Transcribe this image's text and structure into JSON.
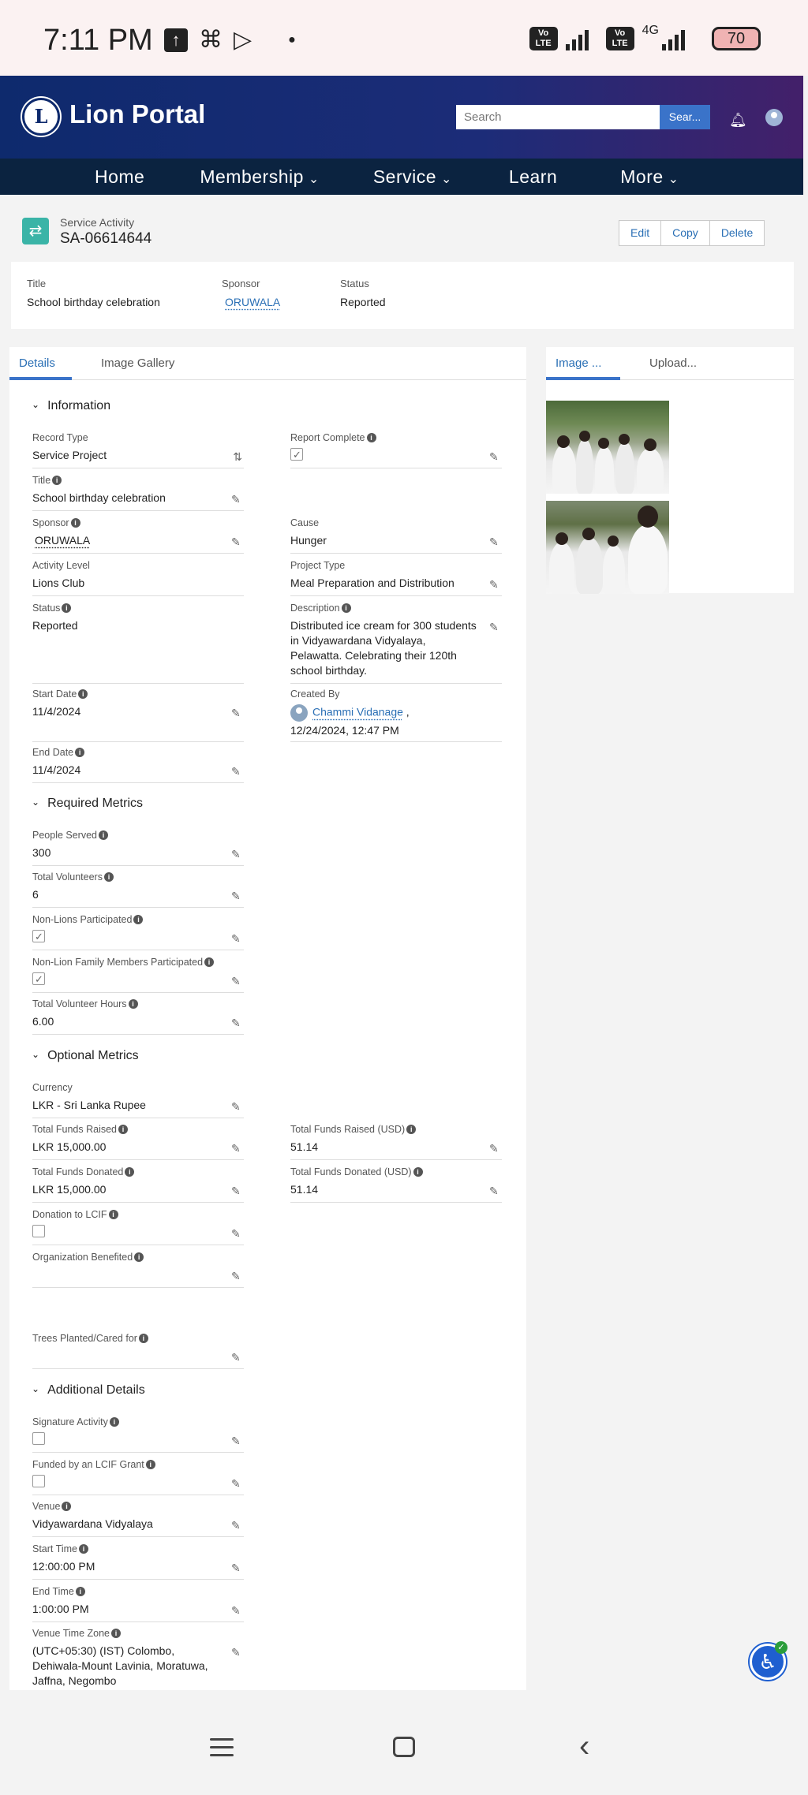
{
  "status_bar": {
    "time": "7:11 PM",
    "network": "4G",
    "volte_label": "Vo LTE",
    "battery": "70"
  },
  "header": {
    "brand": "Lion Portal",
    "search_placeholder": "Search",
    "search_button": "Sear..."
  },
  "nav": {
    "items": [
      "Home",
      "Membership",
      "Service",
      "Learn",
      "More"
    ]
  },
  "record": {
    "object_type": "Service Activity",
    "id": "SA-06614644",
    "buttons": {
      "edit": "Edit",
      "copy": "Copy",
      "delete": "Delete"
    }
  },
  "highlights": {
    "title_label": "Title",
    "title_value": "School birthday celebration",
    "sponsor_label": "Sponsor",
    "sponsor_value": "ORUWALA",
    "status_label": "Status",
    "status_value": "Reported"
  },
  "tabs": {
    "details": "Details",
    "gallery": "Image Gallery"
  },
  "right_tabs": {
    "image": "Image ...",
    "upload": "Upload..."
  },
  "sections": {
    "information": "Information",
    "required": "Required Metrics",
    "optional": "Optional Metrics",
    "additional": "Additional Details"
  },
  "fields": {
    "record_type": {
      "label": "Record Type",
      "value": "Service Project"
    },
    "report_complete": {
      "label": "Report Complete"
    },
    "title": {
      "label": "Title",
      "value": "School birthday celebration"
    },
    "sponsor": {
      "label": "Sponsor",
      "value": "ORUWALA"
    },
    "cause": {
      "label": "Cause",
      "value": "Hunger"
    },
    "activity_level": {
      "label": "Activity Level",
      "value": "Lions Club"
    },
    "project_type": {
      "label": "Project Type",
      "value": "Meal Preparation and Distribution"
    },
    "status": {
      "label": "Status",
      "value": "Reported"
    },
    "description": {
      "label": "Description",
      "value": "Distributed ice cream for 300 students in Vidyawardana Vidyalaya, Pelawatta. Celebrating their 120th school birthday."
    },
    "start_date": {
      "label": "Start Date",
      "value": "11/4/2024"
    },
    "created_by": {
      "label": "Created By",
      "user": "Chammi Vidanage",
      "date": "12/24/2024, 12:47 PM"
    },
    "end_date": {
      "label": "End Date",
      "value": "11/4/2024"
    },
    "people_served": {
      "label": "People Served",
      "value": "300"
    },
    "total_volunteers": {
      "label": "Total Volunteers",
      "value": "6"
    },
    "non_lions": {
      "label": "Non-Lions Participated"
    },
    "non_lion_family": {
      "label": "Non-Lion Family Members Participated"
    },
    "volunteer_hours": {
      "label": "Total Volunteer Hours",
      "value": "6.00"
    },
    "currency": {
      "label": "Currency",
      "value": "LKR - Sri Lanka Rupee"
    },
    "funds_raised": {
      "label": "Total Funds Raised",
      "value": "LKR 15,000.00"
    },
    "funds_raised_usd": {
      "label": "Total Funds Raised (USD)",
      "value": "51.14"
    },
    "funds_donated": {
      "label": "Total Funds Donated",
      "value": "LKR 15,000.00"
    },
    "funds_donated_usd": {
      "label": "Total Funds Donated (USD)",
      "value": "51.14"
    },
    "donation_lcif": {
      "label": "Donation to LCIF"
    },
    "org_benefited": {
      "label": "Organization Benefited"
    },
    "trees": {
      "label": "Trees Planted/Cared for"
    },
    "signature": {
      "label": "Signature Activity"
    },
    "lcif_grant": {
      "label": "Funded by an LCIF Grant"
    },
    "venue": {
      "label": "Venue",
      "value": "Vidyawardana Vidyalaya"
    },
    "start_time": {
      "label": "Start Time",
      "value": "12:00:00 PM"
    },
    "end_time": {
      "label": "End Time",
      "value": "1:00:00 PM"
    },
    "time_zone": {
      "label": "Venue Time Zone",
      "value": "(UTC+05:30) (IST) Colombo, Dehiwala-Mount Lavinia, Moratuwa, Jaffna, Negombo"
    }
  },
  "colors": {
    "header_start": "#0e2a6d",
    "header_end": "#43206a",
    "nav_bg": "#0b2340",
    "link": "#2a6fb5",
    "record_icon": "#3ab4a7",
    "accessibility": "#1f5fd0"
  }
}
